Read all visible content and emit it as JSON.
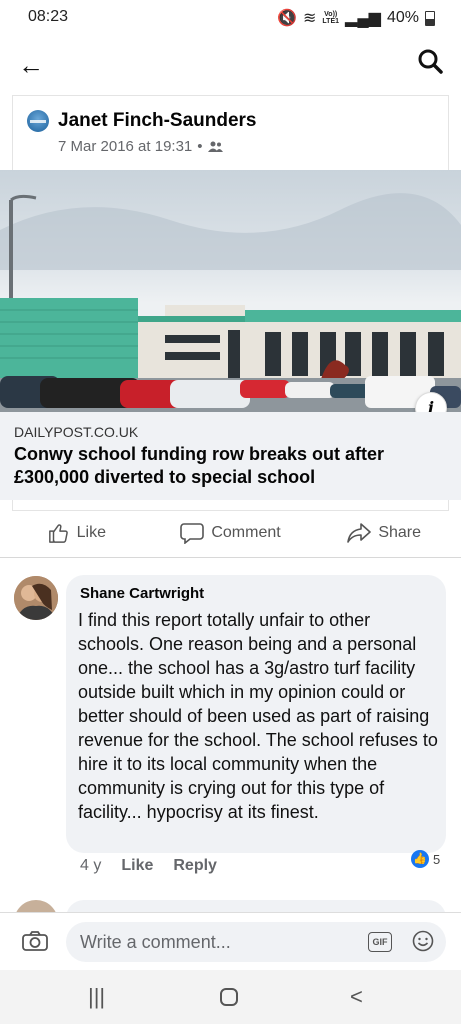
{
  "status_bar": {
    "time": "08:23",
    "network": "LTE1",
    "volte": "Vo))",
    "battery": "40%"
  },
  "post": {
    "author": "Janet Finch-Saunders",
    "timestamp": "7 Mar 2016 at 19:31",
    "separator": "•",
    "audience_icon": "friends-icon"
  },
  "link_preview": {
    "domain": "DAILYPOST.CO.UK",
    "headline": "Conwy school funding row breaks out after £300,000 diverted to special school",
    "info_label": "i"
  },
  "actions": {
    "like": "Like",
    "comment": "Comment",
    "share": "Share"
  },
  "comment": {
    "name": "Shane Cartwright",
    "text": "I find this report totally unfair to other schools. One reason being and a personal one... the school has a 3g/astro turf facility outside built which in my opinion could or better should of been used as part of raising  revenue for the school. The school refuses to hire it to its local community when the community is crying out for this type of facility... hypocrisy at its finest.",
    "age": "4 y",
    "like": "Like",
    "reply": "Reply",
    "reaction_count": "5"
  },
  "composer": {
    "placeholder": "Write a comment...",
    "gif_label": "GIF"
  },
  "colors": {
    "accent": "#1877f2",
    "bubble": "#f0f2f5",
    "text_secondary": "#65676b"
  }
}
